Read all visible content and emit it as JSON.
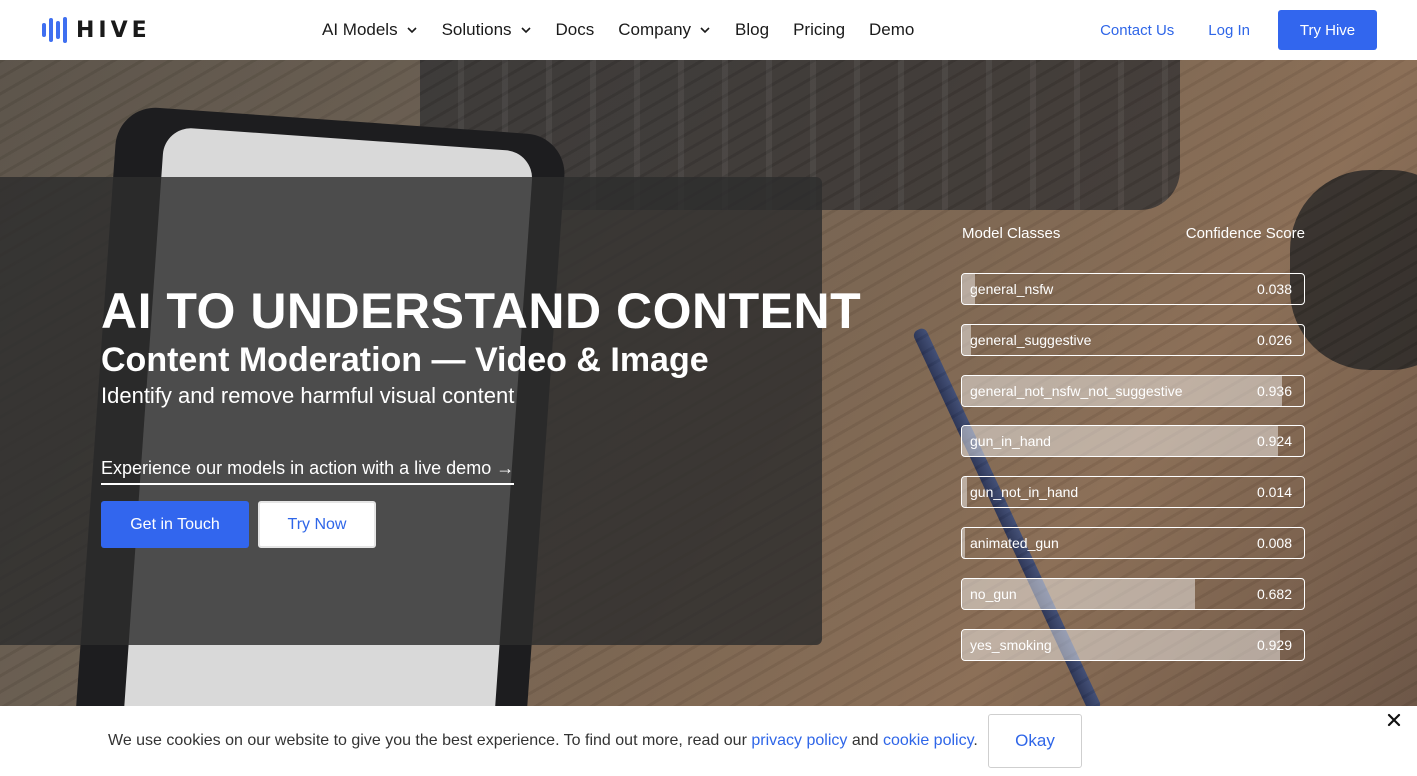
{
  "nav": {
    "logo_text": "HIVE",
    "items": [
      {
        "label": "AI Models",
        "dropdown": true
      },
      {
        "label": "Solutions",
        "dropdown": true
      },
      {
        "label": "Docs",
        "dropdown": false
      },
      {
        "label": "Company",
        "dropdown": true
      },
      {
        "label": "Blog",
        "dropdown": false
      },
      {
        "label": "Pricing",
        "dropdown": false
      },
      {
        "label": "Demo",
        "dropdown": false
      }
    ],
    "contact": "Contact Us",
    "login": "Log In",
    "cta": "Try Hive"
  },
  "hero": {
    "title": "AI TO UNDERSTAND CONTENT",
    "subtitle": "Content Moderation — Video & Image",
    "tagline": "Identify and remove harmful visual content",
    "demo_link": "Experience our models in action with a live demo →",
    "primary_button": "Get in Touch",
    "secondary_button": "Try Now"
  },
  "model_classes": {
    "header_left": "Model Classes",
    "header_right": "Confidence Score",
    "rows": [
      {
        "name": "general_nsfw",
        "score": "0.038",
        "fill": 0.038
      },
      {
        "name": "general_suggestive",
        "score": "0.026",
        "fill": 0.026
      },
      {
        "name": "general_not_nsfw_not_suggestive",
        "score": "0.936",
        "fill": 0.936
      },
      {
        "name": "gun_in_hand",
        "score": "0.924",
        "fill": 0.924
      },
      {
        "name": "gun_not_in_hand",
        "score": "0.014",
        "fill": 0.014
      },
      {
        "name": "animated_gun",
        "score": "0.008",
        "fill": 0.008
      },
      {
        "name": "no_gun",
        "score": "0.682",
        "fill": 0.682
      },
      {
        "name": "yes_smoking",
        "score": "0.929",
        "fill": 0.929
      }
    ]
  },
  "cookie": {
    "text_before": "We use cookies on our website to give you the best experience. To find out more, read our ",
    "privacy_link": "privacy policy",
    "text_middle": " and ",
    "cookie_link": "cookie policy",
    "text_after": ".",
    "okay": "Okay"
  },
  "colors": {
    "accent": "#3266ee",
    "link": "#2f66e8"
  }
}
